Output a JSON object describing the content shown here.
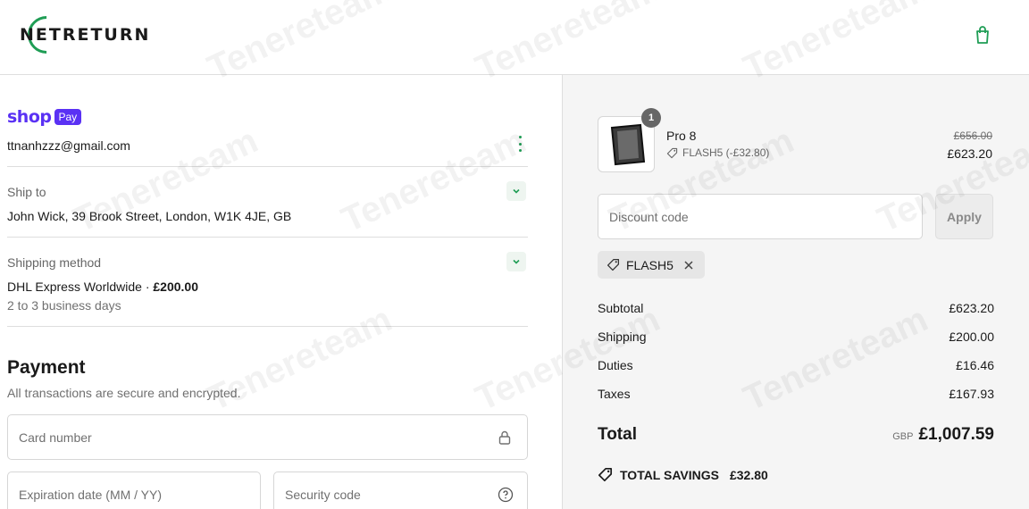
{
  "brand": {
    "logo_text": "NETRETURN"
  },
  "watermark": {
    "text": "Tenereteam"
  },
  "express": {
    "shop_word": "shop",
    "pay_badge": "Pay",
    "email": "ttnanhzzz@gmail.com"
  },
  "ship_to": {
    "label": "Ship to",
    "value": "John Wick, 39 Brook Street, London, W1K 4JE, GB"
  },
  "shipping_method": {
    "label": "Shipping method",
    "carrier": "DHL Express Worldwide",
    "separator": " · ",
    "price": "£200.00",
    "sub": "2 to 3 business days"
  },
  "payment": {
    "title": "Payment",
    "subtitle": "All transactions are secure and encrypted.",
    "card_number_placeholder": "Card number",
    "expiry_placeholder": "Expiration date (MM / YY)",
    "security_placeholder": "Security code"
  },
  "summary": {
    "product": {
      "quantity": "1",
      "name": "Pro 8",
      "discount_line": "FLASH5 (-£32.80)",
      "original_price": "£656.00",
      "price": "£623.20"
    },
    "discount_placeholder": "Discount code",
    "apply_label": "Apply",
    "applied_code": "FLASH5",
    "lines": [
      {
        "label": "Subtotal",
        "value": "£623.20"
      },
      {
        "label": "Shipping",
        "value": "£200.00"
      },
      {
        "label": "Duties",
        "value": "£16.46"
      },
      {
        "label": "Taxes",
        "value": "£167.93"
      }
    ],
    "total_label": "Total",
    "currency": "GBP",
    "total": "£1,007.59",
    "savings_label": "TOTAL SAVINGS",
    "savings_amount": "£32.80"
  },
  "colors": {
    "accent": "#1f9d55",
    "shop_pay": "#5a31f4",
    "summary_bg": "#f5f5f5"
  },
  "icons": [
    "cart-icon",
    "kebab-menu-icon",
    "chevron-down-icon",
    "lock-icon",
    "help-icon",
    "tag-icon",
    "close-icon"
  ]
}
